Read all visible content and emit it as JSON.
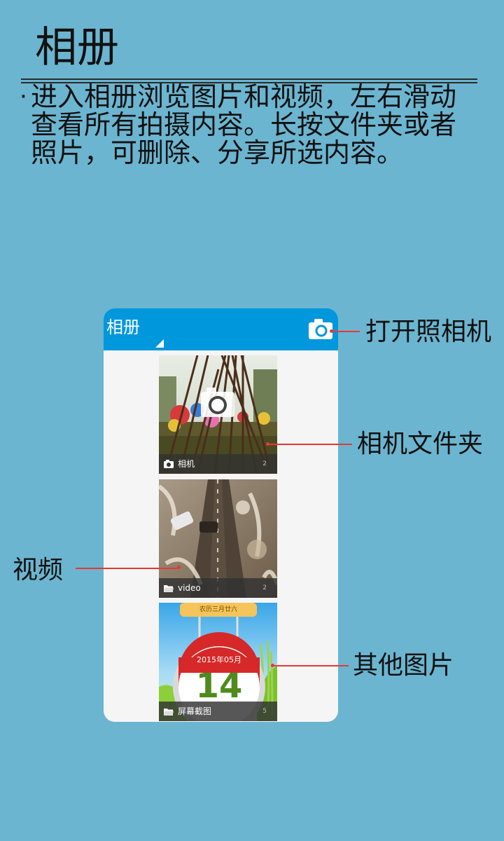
{
  "header": {
    "title": "相册",
    "bullet": "·",
    "description": "进入相册浏览图片和视频，左右滑动查看所有拍摄内容。长按文件夹或者照片，可删除、分享所选内容。"
  },
  "phone": {
    "app_title": "相册",
    "albums": [
      {
        "name": "相机",
        "count": "2",
        "icon": "camera-icon"
      },
      {
        "name": "video",
        "count": "2",
        "icon": "folder-icon"
      },
      {
        "name": "屏幕截图",
        "count": "5",
        "icon": "folder-icon",
        "calendar_banner": "农历三月廿六",
        "calendar_month": "2015年05月",
        "calendar_day": "14"
      }
    ]
  },
  "callouts": {
    "open_camera": "打开照相机",
    "camera_folder": "相机文件夹",
    "video": "视频",
    "other_pictures": "其他图片"
  },
  "colors": {
    "background": "#6bb5d0",
    "app_bar": "#0097dd",
    "callout": "#e53935"
  }
}
